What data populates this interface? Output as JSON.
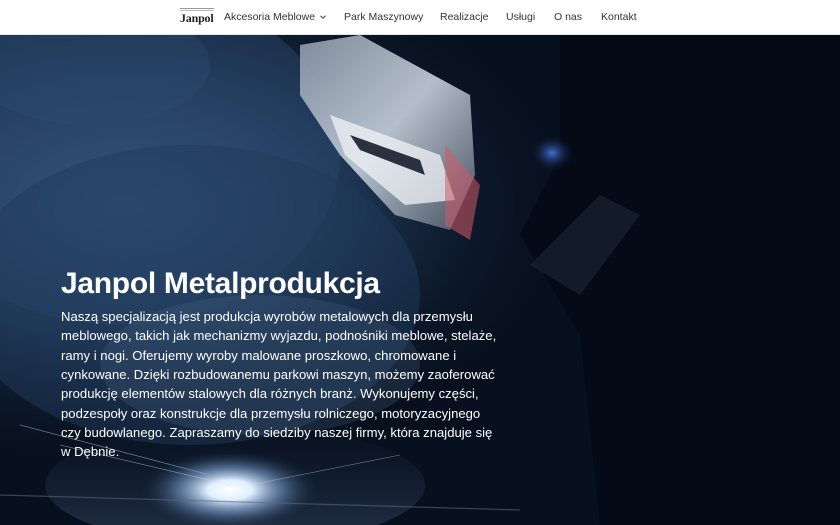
{
  "logo": {
    "text": "Janpol",
    "icon": "company-logo"
  },
  "nav": {
    "items": [
      {
        "label": "Akcesoria Meblowe",
        "has_dropdown": true,
        "icon": "chevron-down-icon"
      },
      {
        "label": "Park Maszynowy"
      },
      {
        "label": "Realizacje"
      },
      {
        "label": "Usługi"
      },
      {
        "label": "O nas"
      },
      {
        "label": "Kontakt"
      }
    ]
  },
  "hero": {
    "title": "Janpol Metalprodukcja",
    "description": "Naszą specjalizacją jest produkcja wyrobów metalowych dla przemysłu meblowego, takich jak mechanizmy wyjazdu, podnośniki meblowe, stelaże, ramy i nogi. Oferujemy wyroby malowane proszkowo, chromowane i cynkowane. Dzięki rozbudowanemu parkowi maszyn, możemy zaoferować produkcję elementów stalowych dla różnych branż. Wykonujemy części, podzespoły oraz konstrukcje dla przemysłu rolniczego, motoryzacyjnego czy budowlanego. Zapraszamy do siedziby naszej firmy, która znajduje się w Dębnie.",
    "background_image": "welder-in-mask-welding-with-sparks"
  },
  "colors": {
    "nav_background": "#ffffff",
    "nav_text": "#333333",
    "hero_text": "#ffffff",
    "hero_background": "#07101e"
  }
}
